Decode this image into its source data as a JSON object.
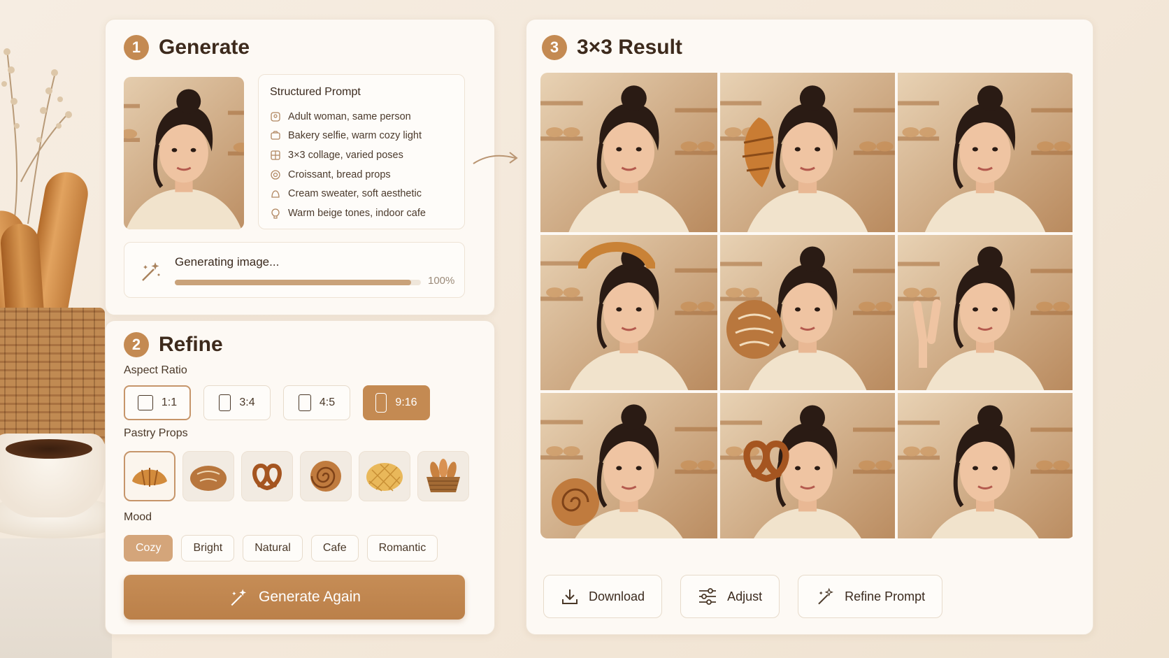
{
  "generate": {
    "step": "1",
    "title": "Generate",
    "prompt_title": "Structured Prompt",
    "prompt_items": [
      {
        "icon": "person-icon",
        "text": "Adult woman, same person"
      },
      {
        "icon": "camera-icon",
        "text": "Bakery selfie, warm cozy light"
      },
      {
        "icon": "grid-icon",
        "text": "3×3 collage, varied poses"
      },
      {
        "icon": "croissant-icon",
        "text": "Croissant, bread props"
      },
      {
        "icon": "sweater-icon",
        "text": "Cream sweater, soft aesthetic"
      },
      {
        "icon": "palette-icon",
        "text": "Warm beige tones, indoor cafe"
      }
    ],
    "progress_label": "Generating image...",
    "progress_value": 1.0,
    "progress_pct": "100%"
  },
  "refine": {
    "step": "2",
    "title": "Refine",
    "aspect_label": "Aspect Ratio",
    "ratios": [
      "1:1",
      "3:4",
      "4:5",
      "9:16"
    ],
    "props_label": "Pastry Props",
    "props": [
      "croissant",
      "round-loaf",
      "pretzel",
      "cinnamon-roll",
      "melon-bun",
      "bread-basket"
    ],
    "mood_label": "Mood",
    "moods": [
      "Cozy",
      "Bright",
      "Natural",
      "Cafe",
      "Romantic"
    ],
    "generate_again": "Generate Again"
  },
  "result": {
    "step": "3",
    "title": "3×3 Result",
    "actions": {
      "download": "Download",
      "adjust": "Adjust",
      "refine_prompt": "Refine Prompt"
    }
  },
  "colors": {
    "accent": "#c48a52",
    "card": "#fdf9f4",
    "background": "#f4e9dc"
  }
}
